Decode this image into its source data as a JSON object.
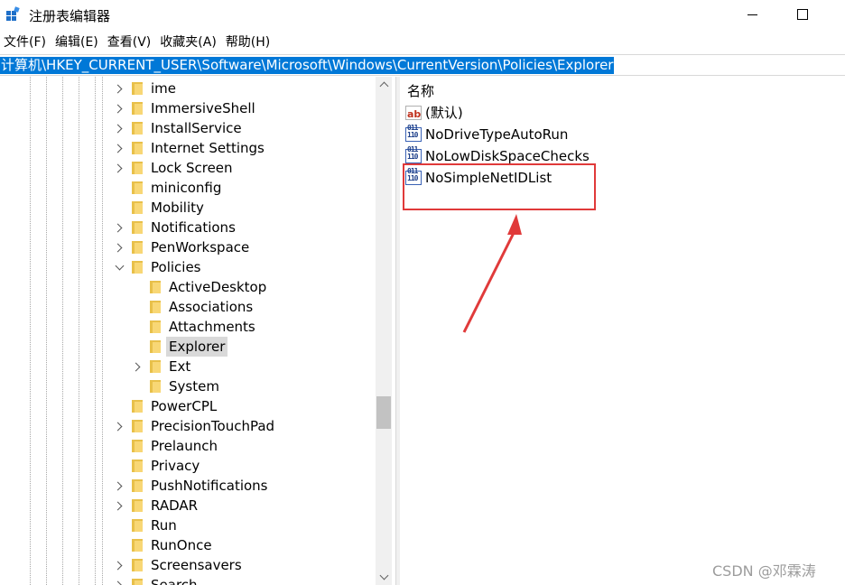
{
  "window": {
    "title": "注册表编辑器"
  },
  "menu": [
    "文件(F)",
    "编辑(E)",
    "查看(V)",
    "收藏夹(A)",
    "帮助(H)"
  ],
  "address": "计算机\\HKEY_CURRENT_USER\\Software\\Microsoft\\Windows\\CurrentVersion\\Policies\\Explorer",
  "tree": [
    {
      "label": "ime",
      "level": 1,
      "expander": "collapsed"
    },
    {
      "label": "ImmersiveShell",
      "level": 1,
      "expander": "collapsed"
    },
    {
      "label": "InstallService",
      "level": 1,
      "expander": "collapsed"
    },
    {
      "label": "Internet Settings",
      "level": 1,
      "expander": "collapsed"
    },
    {
      "label": "Lock Screen",
      "level": 1,
      "expander": "collapsed"
    },
    {
      "label": "miniconfig",
      "level": 1,
      "expander": "none"
    },
    {
      "label": "Mobility",
      "level": 1,
      "expander": "none"
    },
    {
      "label": "Notifications",
      "level": 1,
      "expander": "collapsed"
    },
    {
      "label": "PenWorkspace",
      "level": 1,
      "expander": "collapsed"
    },
    {
      "label": "Policies",
      "level": 1,
      "expander": "expanded"
    },
    {
      "label": "ActiveDesktop",
      "level": 2,
      "expander": "none"
    },
    {
      "label": "Associations",
      "level": 2,
      "expander": "none"
    },
    {
      "label": "Attachments",
      "level": 2,
      "expander": "none"
    },
    {
      "label": "Explorer",
      "level": 2,
      "expander": "none",
      "selected": true
    },
    {
      "label": "Ext",
      "level": 2,
      "expander": "collapsed"
    },
    {
      "label": "System",
      "level": 2,
      "expander": "none"
    },
    {
      "label": "PowerCPL",
      "level": 1,
      "expander": "none"
    },
    {
      "label": "PrecisionTouchPad",
      "level": 1,
      "expander": "collapsed"
    },
    {
      "label": "Prelaunch",
      "level": 1,
      "expander": "none"
    },
    {
      "label": "Privacy",
      "level": 1,
      "expander": "none"
    },
    {
      "label": "PushNotifications",
      "level": 1,
      "expander": "collapsed"
    },
    {
      "label": "RADAR",
      "level": 1,
      "expander": "collapsed"
    },
    {
      "label": "Run",
      "level": 1,
      "expander": "none"
    },
    {
      "label": "RunOnce",
      "level": 1,
      "expander": "none"
    },
    {
      "label": "Screensavers",
      "level": 1,
      "expander": "collapsed"
    },
    {
      "label": "Search",
      "level": 1,
      "expander": "collapsed"
    }
  ],
  "values_pane": {
    "column_header": "名称",
    "items": [
      {
        "name": "(默认)",
        "icon": "string-value-icon"
      },
      {
        "name": "NoDriveTypeAutoRun",
        "icon": "binary-value-icon"
      },
      {
        "name": "NoLowDiskSpaceChecks",
        "icon": "binary-value-icon"
      },
      {
        "name": "NoSimpleNetIDList",
        "icon": "binary-value-icon"
      }
    ]
  },
  "annotation": {
    "color": "#e03a3a"
  },
  "watermark": "CSDN @邓霖涛",
  "colors": {
    "selection": "#0078d7",
    "folder": "#f8d775"
  }
}
